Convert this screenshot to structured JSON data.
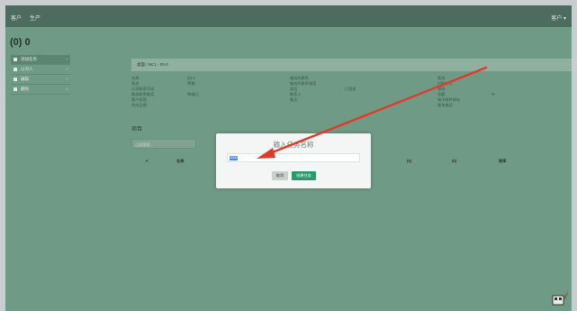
{
  "topbar": {
    "nav": [
      "客户",
      "生产"
    ],
    "user": "客户 ▾"
  },
  "page": {
    "title": "(0) 0"
  },
  "sidebar": {
    "items": [
      {
        "label": "添加任务",
        "icon": "chart-icon"
      },
      {
        "label": "公司人",
        "icon": "file-icon"
      },
      {
        "label": "编辑",
        "icon": "pencil-icon"
      },
      {
        "label": "删除",
        "icon": "trash-icon"
      }
    ]
  },
  "breadcrumb": "桌面 / NC1 - 00-0",
  "fields": {
    "col1": [
      "名称",
      "状态",
      "公司联系号码",
      "商务联系电话",
      "客户经理",
      "完成日期"
    ],
    "col2": [
      "(0) 0",
      "草稿",
      "",
      "审核(-)",
      "",
      ""
    ],
    "col3": [
      "服务的联系",
      "服务的联系电话",
      "语言",
      "联系人",
      "备注"
    ],
    "col4": [
      "",
      "",
      "已签发",
      "",
      ""
    ],
    "col5": [
      "状态",
      "付款方式",
      "税率",
      "金额",
      "电子邮件地址",
      "联系电话"
    ],
    "col6": [
      "",
      "",
      "",
      "%",
      "",
      ""
    ]
  },
  "section": {
    "title": "项目",
    "search_placeholder": "过滤搜索..."
  },
  "table_headers": [
    "#",
    "名称",
    "(0)",
    "(0)",
    "税率"
  ],
  "modal": {
    "title": "输入任务名称",
    "input_value": "0000",
    "cancel": "取消",
    "create": "创建任务"
  },
  "colors": {
    "arrow": "#e23a2a",
    "primary": "#2a9a6a"
  }
}
